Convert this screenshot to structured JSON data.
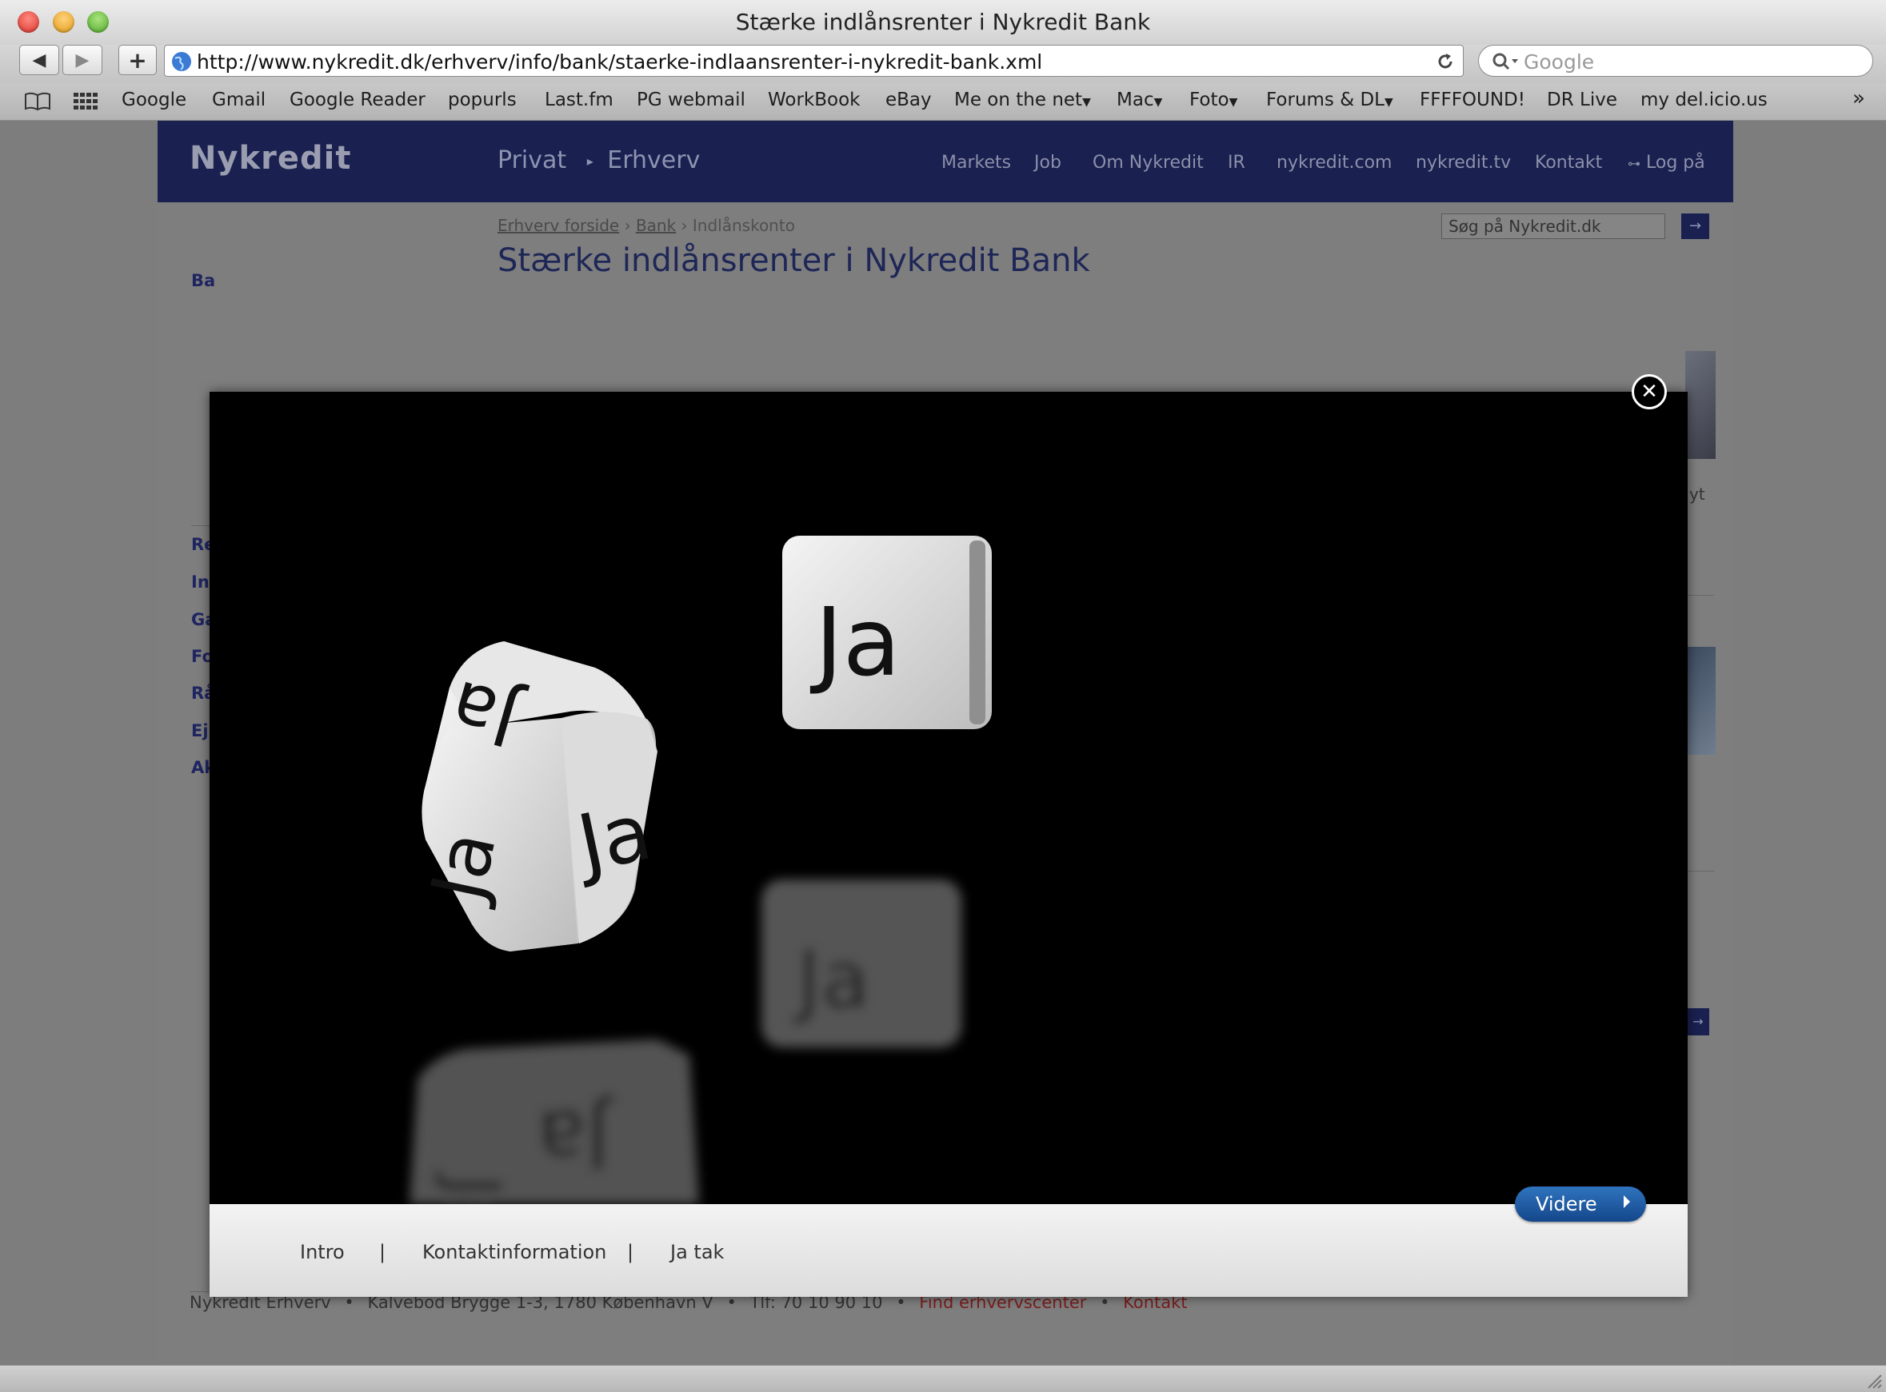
{
  "window": {
    "title": "Stærke indlånsrenter i Nykredit Bank"
  },
  "toolbar": {
    "back_label": "◀",
    "forward_label": "▶",
    "add_label": "+",
    "url": "http://www.nykredit.dk/erhverv/info/bank/staerke-indlaansrenter-i-nykredit-bank.xml",
    "search_placeholder": "Google"
  },
  "bookmarks": {
    "items": [
      "Google",
      "Gmail",
      "Google Reader",
      "popurls",
      "Last.fm",
      "PG webmail",
      "WorkBook",
      "eBay",
      "Me on the net",
      "Mac",
      "Foto",
      "Forums & DL",
      "FFFFOUND!",
      "DR Live",
      "my del.icio.us"
    ],
    "more": "»"
  },
  "site": {
    "logo": "Nykredit",
    "topnav": {
      "privat": "Privat",
      "erhverv": "Erhverv"
    },
    "nav": [
      "Markets",
      "Job",
      "Om Nykredit",
      "IR",
      "nykredit.com",
      "nykredit.tv",
      "Kontakt",
      "Log på"
    ],
    "breadcrumb": [
      "Erhverv forside",
      "Bank",
      "Indlånskonto"
    ],
    "search_placeholder": "Søg på Nykredit.dk",
    "heading": "Stærke indlånsrenter i Nykredit Bank",
    "left_nav": [
      "Ba",
      "Re",
      "In",
      "Ga",
      "Fo",
      "Rå",
      "Ej",
      "Ak"
    ],
    "right_snippet": "yt"
  },
  "modal": {
    "die_label": "Ja",
    "tabs": [
      "Intro",
      "Kontaktinformation",
      "Ja tak"
    ],
    "separator": "|",
    "next_button": "Videre",
    "close_label": "✕"
  },
  "footer": {
    "company": "Nykredit Erhverv",
    "address": "Kalvebod Brygge 1-3, 1780 København V",
    "phone": "Tlf: 70 10 90 10",
    "find_link": "Find erhvervscenter",
    "contact_link": "Kontakt",
    "bullet": "•"
  }
}
